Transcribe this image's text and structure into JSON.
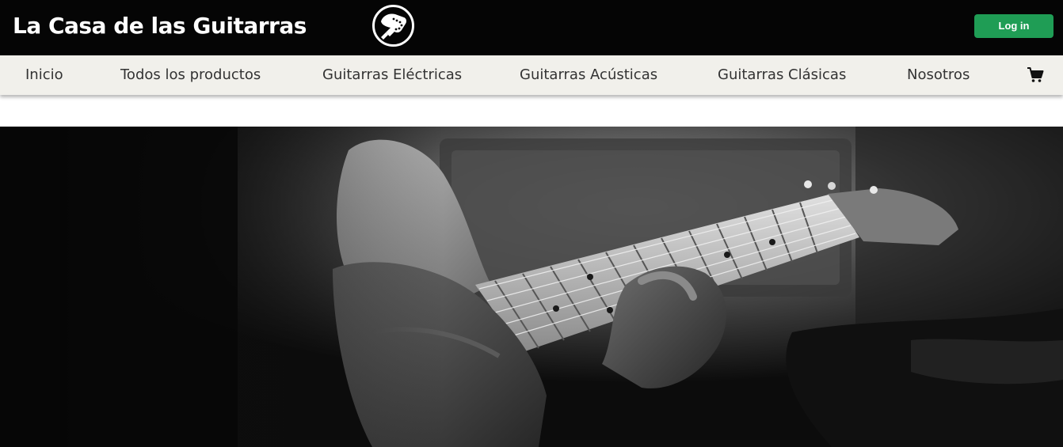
{
  "header": {
    "brand": "La Casa de las Guitarras",
    "login_label": "Log in",
    "logo_icon": "guitar-headstock-icon",
    "login_color": "#1f9d55",
    "background": "#050505"
  },
  "nav": {
    "items": [
      {
        "label": "Inicio"
      },
      {
        "label": "Todos los productos"
      },
      {
        "label": "Guitarras Eléctricas"
      },
      {
        "label": "Guitarras Acústicas"
      },
      {
        "label": "Guitarras Clásicas"
      },
      {
        "label": "Nosotros"
      }
    ],
    "cart_icon": "shopping-cart-icon",
    "background": "#f1f0eb"
  },
  "hero": {
    "image": "black-and-white photo of hands playing an electric guitar neck in front of an amplifier"
  }
}
